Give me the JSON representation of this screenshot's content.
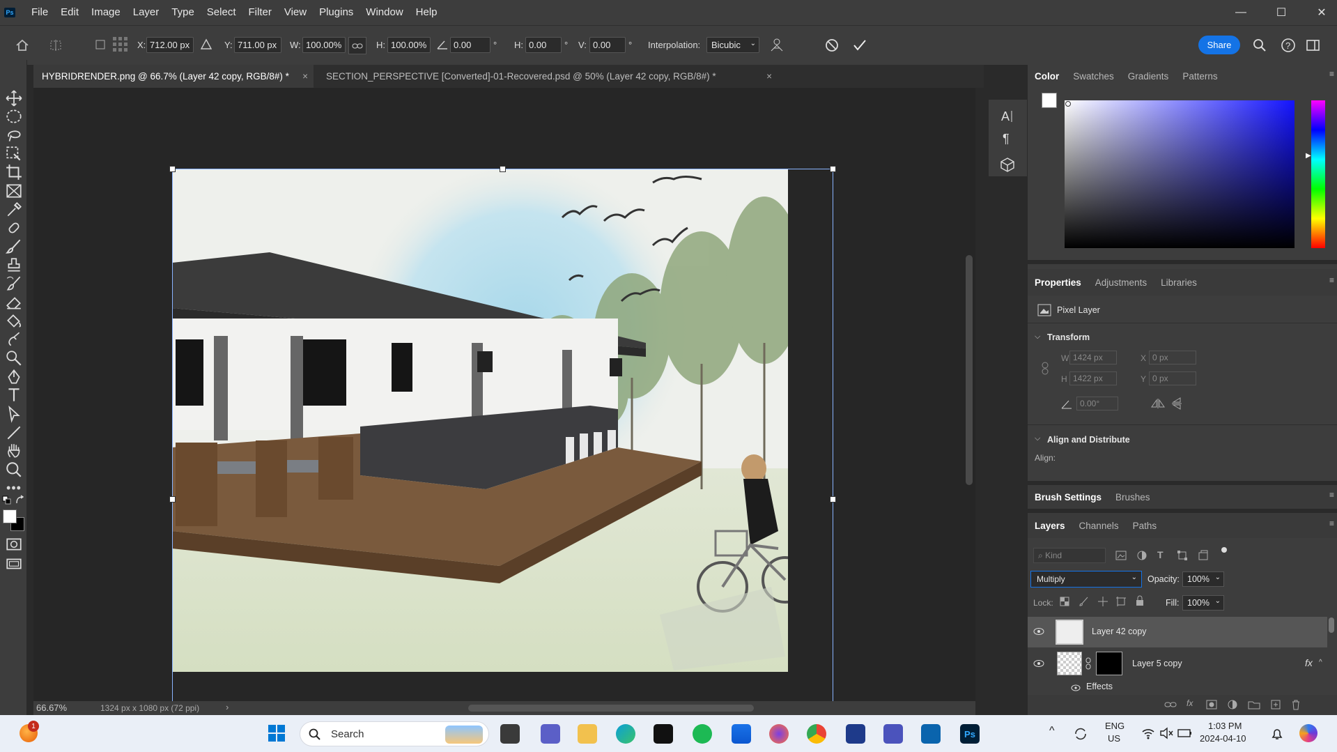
{
  "app": {
    "logo": "Ps"
  },
  "menu": [
    "File",
    "Edit",
    "Image",
    "Layer",
    "Type",
    "Select",
    "Filter",
    "View",
    "Plugins",
    "Window",
    "Help"
  ],
  "window_controls": {
    "minimize": "—",
    "maximize": "☐",
    "close": "✕"
  },
  "options": {
    "x_label": "X:",
    "x_value": "712.00 px",
    "y_label": "Y:",
    "y_value": "711.00 px",
    "w_label": "W:",
    "w_value": "100.00%",
    "h_label": "H:",
    "h_value": "100.00%",
    "angle_value": "0.00",
    "deg": "°",
    "hskew_label": "H:",
    "hskew_value": "0.00",
    "vskew_label": "V:",
    "vskew_value": "0.00",
    "interp_label": "Interpolation:",
    "interp_value": "Bicubic",
    "share_label": "Share"
  },
  "tabs": [
    {
      "label": "HYBRIDRENDER.png @ 66.7% (Layer 42 copy, RGB/8#) *"
    },
    {
      "label": "SECTION_PERSPECTIVE [Converted]-01-Recovered.psd @ 50% (Layer 42 copy, RGB/8#) *"
    }
  ],
  "tab_close": "×",
  "panels": {
    "color_tabs": [
      "Color",
      "Swatches",
      "Gradients",
      "Patterns"
    ],
    "props_tabs": [
      "Properties",
      "Adjustments",
      "Libraries"
    ],
    "pixel_layer": "Pixel Layer",
    "transform": "Transform",
    "w_label": "W",
    "w_value": "1424 px",
    "h_label": "H",
    "h_value": "1422 px",
    "x_label": "X",
    "x_value": "0 px",
    "y_label": "Y",
    "y_value": "0 px",
    "angle_value": "0.00°",
    "align_dist": "Align and Distribute",
    "align_label": "Align:",
    "brush_tabs": [
      "Brush Settings",
      "Brushes"
    ],
    "layers_tabs": [
      "Layers",
      "Channels",
      "Paths"
    ],
    "kind_placeholder": "Kind",
    "blend_mode": "Multiply",
    "opacity_label": "Opacity:",
    "opacity_value": "100%",
    "lock_label": "Lock:",
    "fill_label": "Fill:",
    "fill_value": "100%",
    "layers": [
      {
        "name": "Layer 42 copy"
      },
      {
        "name": "Layer 5 copy",
        "fx": "fx"
      }
    ],
    "effects_label": "Effects"
  },
  "status": {
    "zoom": "66.67%",
    "doc_info": "1324 px x 1080 px (72 ppi)"
  },
  "taskbar": {
    "search_label": "Search",
    "lang_line1": "ENG",
    "lang_line2": "US",
    "time": "1:03 PM",
    "date": "2024-04-10",
    "notif_badge": "1"
  },
  "colors": {
    "accent": "#1473e6",
    "spotify": "#1db954"
  }
}
